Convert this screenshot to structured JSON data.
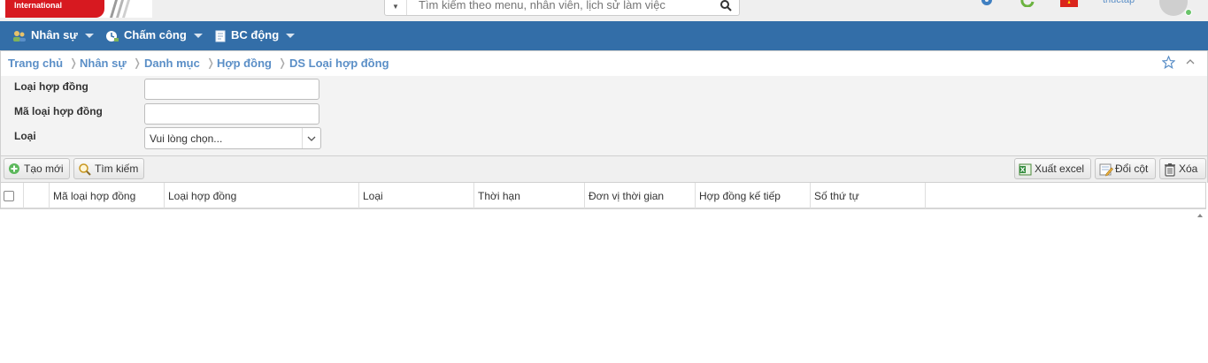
{
  "header": {
    "logo_text": "International",
    "search_placeholder": "Tìm kiếm theo menu, nhân viên, lịch sử làm việc",
    "user_name": "thuctap"
  },
  "nav": {
    "items": [
      {
        "label": "Nhân sự"
      },
      {
        "label": "Chấm công"
      },
      {
        "label": "BC động"
      }
    ]
  },
  "breadcrumb": {
    "items": [
      "Trang chủ",
      "Nhân sự",
      "Danh mục",
      "Hợp đồng",
      "DS Loại hợp đồng"
    ]
  },
  "filter": {
    "contract_type_label": "Loại hợp đồng",
    "contract_type_value": "",
    "contract_code_label": "Mã loại hợp đồng",
    "contract_code_value": "",
    "kind_label": "Loại",
    "kind_selected": "Vui lòng chọn..."
  },
  "toolbar": {
    "create_label": "Tạo mới",
    "search_label": "Tìm kiếm",
    "export_label": "Xuất excel",
    "columns_label": "Đổi cột",
    "delete_label": "Xóa"
  },
  "grid": {
    "columns": [
      "Mã loại hợp đồng",
      "Loại hợp đồng",
      "Loại",
      "Thời hạn",
      "Đơn vị thời gian",
      "Hợp đồng kế tiếp",
      "Số thứ tự"
    ],
    "rows": []
  },
  "colors": {
    "nav_bg": "#336ea8",
    "link": "#5b8fc7",
    "brand_red": "#d71920"
  }
}
